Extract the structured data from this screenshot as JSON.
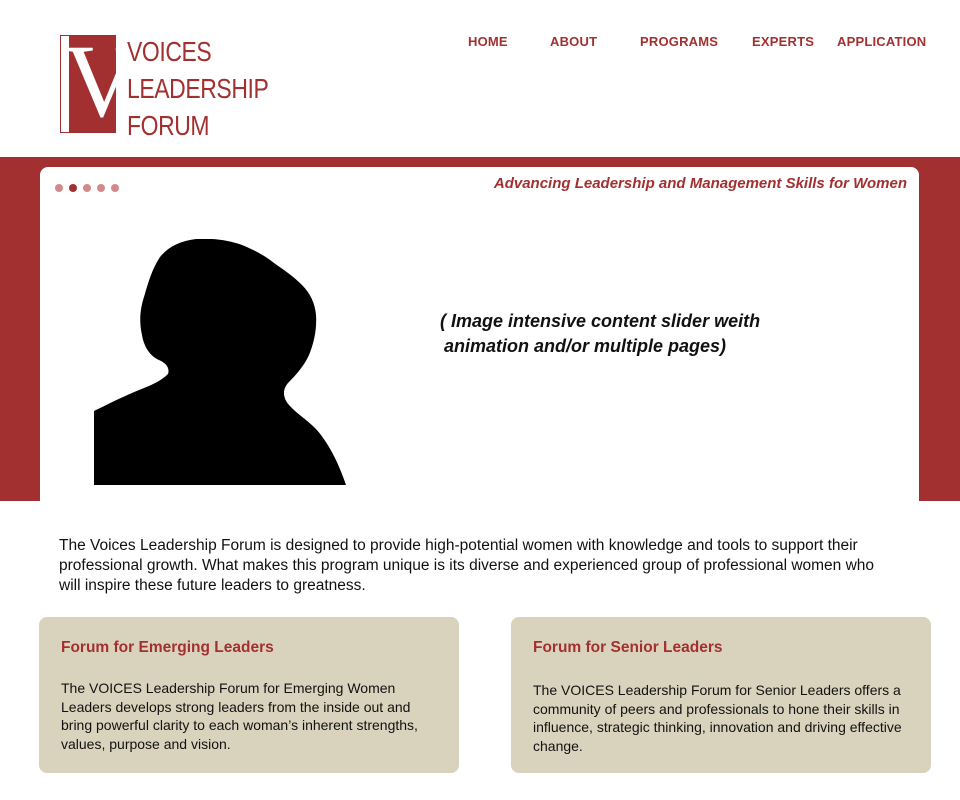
{
  "brand": {
    "logo_letter": "V",
    "name_lines": [
      "VOICES",
      "LEADERSHIP",
      "FORUM"
    ],
    "accent_color": "#a33030"
  },
  "nav": {
    "items": [
      "HOME",
      "ABOUT",
      "PROGRAMS",
      "EXPERTS",
      "APPLICATION"
    ]
  },
  "hero": {
    "tagline": "Advancing Leadership and Management Skills for Women",
    "placeholder_lines": [
      "( Image intensive content slider weith",
      "animation and/or multiple pages)"
    ],
    "slide_count": 5,
    "active_slide": 2,
    "image": "silhouette-portrait"
  },
  "intro": {
    "text": "The Voices Leadership Forum is designed to provide high-potential women with knowledge and tools to support their professional growth. What makes this program unique is its diverse and experienced group of professional women who will inspire these future leaders to greatness."
  },
  "cards": [
    {
      "title": "Forum for Emerging Leaders",
      "body": "The VOICES Leadership Forum for Emerging Women Leaders develops strong leaders from the inside out and bring powerful clarity to each woman’s inherent strengths, values, purpose and vision."
    },
    {
      "title": "Forum for Senior Leaders",
      "body": "The VOICES Leadership Forum for Senior Leaders offers a community of peers and professionals to hone their skills in influence, strategic thinking, innovation and driving effective change."
    }
  ],
  "colors": {
    "band": "#a33030",
    "card_bg": "#d9d3bd",
    "dot_inactive": "#d08a8a"
  }
}
